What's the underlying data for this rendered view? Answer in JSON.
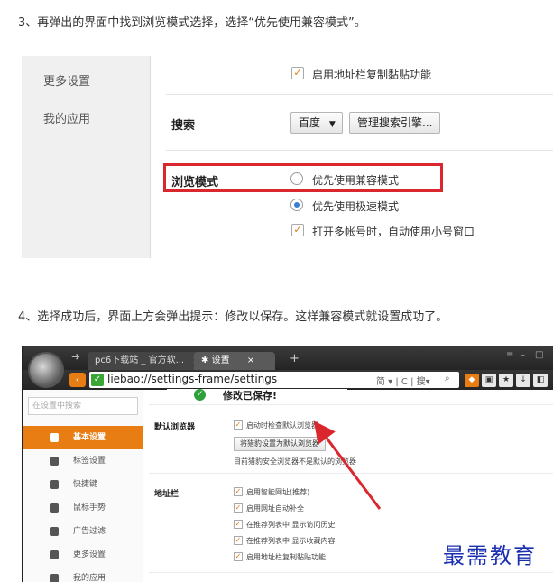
{
  "steps": {
    "step3": "3、再弹出的界面中找到浏览模式选择，选择“优先使用兼容模式”。",
    "step4": "4、选择成功后，界面上方会弹出提示：修改以保存。这样兼容模式就设置成功了。"
  },
  "shot1": {
    "sidebar": [
      "更多设置",
      "我的应用"
    ],
    "address_copy_paste": "启用地址栏复制黏贴功能",
    "search_label": "搜索",
    "search_engine": "百度",
    "manage_search_button": "管理搜索引擎...",
    "browse_mode_label": "浏览模式",
    "mode_compat": "优先使用兼容模式",
    "mode_speed": "优先使用极速模式",
    "multi_account": "打开多帐号时，自动使用小号窗口"
  },
  "shot2": {
    "tabs": [
      "pc6下载站 _ 官方软...",
      "设置"
    ],
    "url": "liebao://settings-frame/settings",
    "url_right": "简 ▾ | C | 搜▾",
    "search_placeholder": "在设置中搜索",
    "nav_items": [
      "基本设置",
      "标签设置",
      "快捷键",
      "鼠标手势",
      "广告过滤",
      "更多设置",
      "我的应用"
    ],
    "toast": "修改已保存!",
    "default_browser_label": "默认浏览器",
    "check_default": "启动时检查默认浏览器",
    "set_default_button": "将猎豹设置为默认浏览器",
    "not_default_note": "目前猎豹安全浏览器不是默认的浏览器",
    "address_bar_label": "地址栏",
    "address_options": [
      "启用智能网址(推荐)",
      "启用网址自动补全",
      "在推荐列表中 显示访问历史",
      "在推荐列表中 显示收藏内容",
      "启用地址栏复制黏贴功能"
    ],
    "watermark": "最需教育"
  },
  "colors": {
    "accent": "#e87d14",
    "highlight_box": "#d9272d",
    "watermark": "#1a2fb0"
  }
}
